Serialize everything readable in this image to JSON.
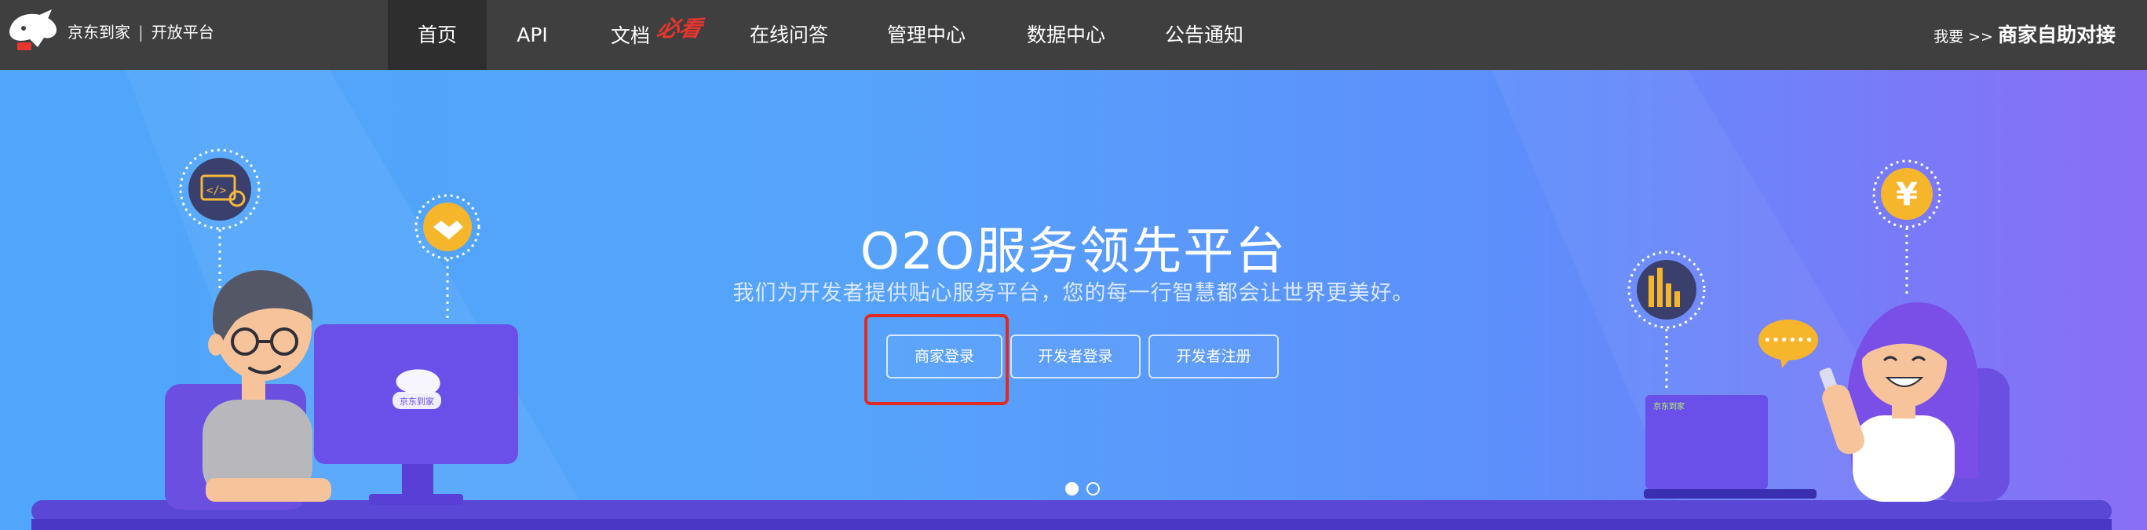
{
  "brand": {
    "name": "京东到家",
    "separator": "|",
    "platform": "开放平台"
  },
  "nav": {
    "items": [
      {
        "label": "首页",
        "active": true
      },
      {
        "label": "API",
        "active": false
      },
      {
        "label": "文档",
        "badge": "必看",
        "active": false
      },
      {
        "label": "在线问答",
        "active": false
      },
      {
        "label": "管理中心",
        "active": false
      },
      {
        "label": "数据中心",
        "active": false
      },
      {
        "label": "公告通知",
        "active": false
      }
    ],
    "self_serve": {
      "prefix": "我要 >>",
      "label": "商家自助对接"
    }
  },
  "hero": {
    "title": "O2O服务领先平台",
    "subtitle": "我们为开发者提供贴心服务平台，您的每一行智慧都会让世界更美好。",
    "buttons": [
      {
        "label": "商家登录",
        "highlighted": true
      },
      {
        "label": "开发者登录"
      },
      {
        "label": "开发者注册"
      }
    ],
    "carousel": {
      "total": 2,
      "current": 1
    },
    "illustration": {
      "monitor_logo": "京东到家",
      "laptop_logo": "京东到家",
      "speech_bubble": "••••••",
      "coin_symbol": "¥"
    }
  },
  "colors": {
    "navbar_bg": "#3f3f3f",
    "hero_gradient_start": "#4fa6fb",
    "hero_gradient_end": "#8a6ef6",
    "highlight_border": "#e02a22",
    "must_read_badge": "#e8362e"
  },
  "icons": [
    "logo-icon",
    "code-settings-icon",
    "handshake-icon",
    "yen-coin-icon",
    "bar-chart-icon",
    "speech-bubble-icon"
  ]
}
